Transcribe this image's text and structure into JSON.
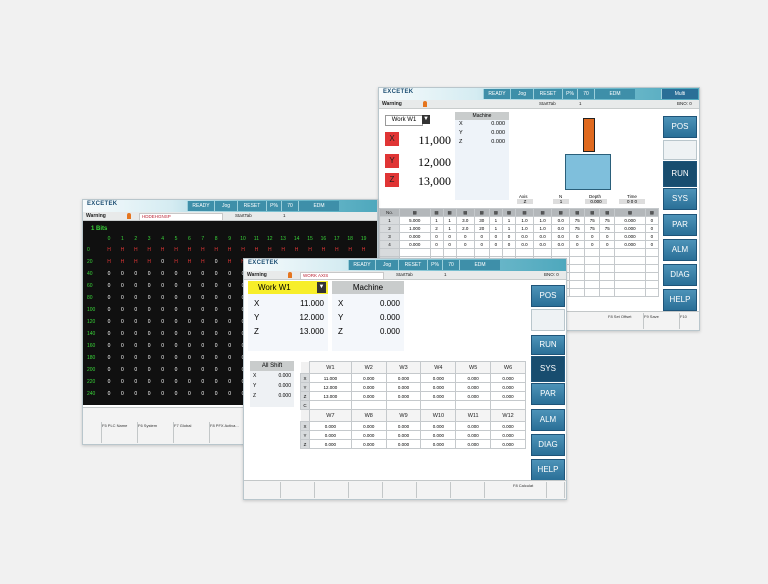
{
  "common": {
    "logo": "EXCETEK",
    "buttons": [
      "READY",
      "Jog",
      "RESET",
      "P%",
      "70",
      "EDM"
    ],
    "status_warning": "Warning"
  },
  "back_window": {
    "toolbar_extra": [
      "Multi"
    ],
    "status_mid": "StartTab",
    "status_num": "1",
    "status_right": "BNO: 0",
    "work": {
      "label": "Work W1",
      "axes": [
        {
          "axis": "X",
          "value": "11,000"
        },
        {
          "axis": "Y",
          "value": "12,000"
        },
        {
          "axis": "Z",
          "value": "13,000"
        }
      ]
    },
    "machine": {
      "label": "Machine",
      "rows": [
        {
          "axis": "X",
          "value": "0.000"
        },
        {
          "axis": "Y",
          "value": "0.000"
        },
        {
          "axis": "Z",
          "value": "0.000"
        }
      ]
    },
    "info": [
      {
        "label": "Axis",
        "value": "Z"
      },
      {
        "label": "N",
        "value": "1"
      },
      {
        "label": "Depth",
        "value": "0.000"
      },
      {
        "label": "Time",
        "value": "0   0   0"
      }
    ],
    "side_buttons": [
      "POS",
      "",
      "RUN",
      "SYS",
      "PAR",
      "ALM",
      "DIAG",
      "HELP"
    ],
    "table_header": [
      "No.",
      "",
      "",
      "",
      "",
      "",
      "",
      "",
      "",
      "",
      "",
      "",
      "",
      "",
      "",
      ""
    ],
    "table_rows": [
      [
        "1",
        "5.000",
        "1",
        "1",
        "3.0",
        "30",
        "1",
        "1",
        "1.0",
        "1.0",
        "0.0",
        "75",
        "75",
        "75",
        "0.000",
        "0"
      ],
      [
        "2",
        "1.000",
        "2",
        "1",
        "2.0",
        "20",
        "1",
        "1",
        "1.0",
        "1.0",
        "0.0",
        "75",
        "75",
        "75",
        "0.000",
        "0"
      ],
      [
        "3",
        "0.000",
        "0",
        "0",
        "0",
        "0",
        "0",
        "0",
        "0.0",
        "0.0",
        "0.0",
        "0",
        "0",
        "0",
        "0.000",
        "0"
      ],
      [
        "4",
        "0.000",
        "0",
        "0",
        "0",
        "0",
        "0",
        "0",
        "0.0",
        "0.0",
        "0.0",
        "0",
        "0",
        "0",
        "0.000",
        "0"
      ]
    ],
    "footer": [
      "",
      "",
      "",
      "",
      "",
      "F8 Set Offset",
      "F9 Save",
      "F10"
    ]
  },
  "plc_window": {
    "status_field": "HDDEHGNSP",
    "status_mid": "StartTab",
    "status_num": "1",
    "title": "1 Bits",
    "col_headers": [
      "0",
      "1",
      "2",
      "3",
      "4",
      "5",
      "6",
      "7",
      "8",
      "9",
      "10",
      "11",
      "12",
      "13",
      "14",
      "15",
      "16",
      "17",
      "18",
      "19"
    ],
    "rows": [
      {
        "label": "0",
        "vals": [
          "H",
          "H",
          "H",
          "H",
          "H",
          "H",
          "H",
          "H",
          "H",
          "H",
          "H",
          "H",
          "H",
          "H",
          "H",
          "H",
          "H",
          "H",
          "H",
          "H"
        ]
      },
      {
        "label": "20",
        "vals": [
          "H",
          "H",
          "H",
          "H",
          "0",
          "H",
          "H",
          "H",
          "0",
          "H",
          "H",
          "0",
          "0",
          "0",
          "0",
          "0",
          "0",
          "0",
          "0",
          "0"
        ]
      },
      {
        "label": "40",
        "vals": [
          "0",
          "0",
          "0",
          "0",
          "0",
          "0",
          "0",
          "0",
          "0",
          "0",
          "0",
          "0",
          "0",
          "0",
          "0",
          "0",
          "0",
          "0",
          "0",
          "0"
        ]
      },
      {
        "label": "60",
        "vals": [
          "0",
          "0",
          "0",
          "0",
          "0",
          "0",
          "0",
          "0",
          "0",
          "0",
          "0",
          "0",
          "0",
          "0",
          "0",
          "0",
          "0",
          "0",
          "0",
          "0"
        ]
      },
      {
        "label": "80",
        "vals": [
          "0",
          "0",
          "0",
          "0",
          "0",
          "0",
          "0",
          "0",
          "0",
          "0",
          "0",
          "0",
          "0",
          "0",
          "0",
          "0",
          "0",
          "0",
          "0",
          "0"
        ]
      },
      {
        "label": "100",
        "vals": [
          "0",
          "0",
          "0",
          "0",
          "0",
          "0",
          "0",
          "0",
          "0",
          "0",
          "0",
          "0",
          "0",
          "0",
          "0",
          "0",
          "0",
          "0",
          "0",
          "0"
        ]
      },
      {
        "label": "120",
        "vals": [
          "0",
          "0",
          "0",
          "0",
          "0",
          "0",
          "0",
          "0",
          "0",
          "0",
          "0",
          "0",
          "0",
          "0",
          "0",
          "0",
          "0",
          "0",
          "0",
          "0"
        ]
      },
      {
        "label": "140",
        "vals": [
          "0",
          "0",
          "0",
          "0",
          "0",
          "0",
          "0",
          "0",
          "0",
          "0",
          "0",
          "0",
          "0",
          "0",
          "0",
          "0",
          "0",
          "0",
          "0",
          "0"
        ]
      },
      {
        "label": "160",
        "vals": [
          "0",
          "0",
          "0",
          "0",
          "0",
          "0",
          "0",
          "0",
          "0",
          "0",
          "0",
          "0",
          "0",
          "0",
          "0",
          "0",
          "0",
          "0",
          "0",
          "0"
        ]
      },
      {
        "label": "180",
        "vals": [
          "0",
          "0",
          "0",
          "0",
          "0",
          "0",
          "0",
          "0",
          "0",
          "0",
          "0",
          "0",
          "0",
          "0",
          "0",
          "0",
          "0",
          "0",
          "0",
          "0"
        ]
      },
      {
        "label": "200",
        "vals": [
          "0",
          "0",
          "0",
          "0",
          "0",
          "0",
          "0",
          "0",
          "0",
          "0",
          "0",
          "0",
          "0",
          "0",
          "0",
          "0",
          "0",
          "0",
          "0",
          "0"
        ]
      },
      {
        "label": "220",
        "vals": [
          "0",
          "0",
          "0",
          "0",
          "0",
          "0",
          "0",
          "0",
          "0",
          "0",
          "0",
          "0",
          "0",
          "0",
          "0",
          "0",
          "0",
          "0",
          "0",
          "0"
        ]
      },
      {
        "label": "240",
        "vals": [
          "0",
          "0",
          "0",
          "0",
          "0",
          "0",
          "0",
          "0",
          "0",
          "0",
          "0",
          "0",
          "0",
          "0",
          "0",
          "0",
          "0",
          "0",
          "0",
          "0"
        ]
      }
    ],
    "footer": [
      "",
      "F5 PLC Name",
      "F6 System",
      "F7 Global",
      "F8 PFX Activa..."
    ]
  },
  "front_window": {
    "status_field": "WORK AXIS",
    "status_mid": "StartTab",
    "status_num": "1",
    "status_right": "BNO: 0",
    "work": {
      "label": "Work W1",
      "rows": [
        {
          "axis": "X",
          "value": "11.000"
        },
        {
          "axis": "Y",
          "value": "12.000"
        },
        {
          "axis": "Z",
          "value": "13.000"
        }
      ]
    },
    "machine": {
      "label": "Machine",
      "rows": [
        {
          "axis": "X",
          "value": "0.000"
        },
        {
          "axis": "Y",
          "value": "0.000"
        },
        {
          "axis": "Z",
          "value": "0.000"
        }
      ]
    },
    "all_shift": {
      "label": "All Shift",
      "rows": [
        {
          "axis": "X",
          "value": "0.000"
        },
        {
          "axis": "Y",
          "value": "0.000"
        },
        {
          "axis": "Z",
          "value": "0.000"
        }
      ]
    },
    "offsets_top": {
      "headers": [
        "W1",
        "W2",
        "W3",
        "W4",
        "W5",
        "W6"
      ],
      "axes": [
        "X",
        "Y",
        "Z",
        "C"
      ],
      "rows": [
        [
          "11.000",
          "0.000",
          "0.000",
          "0.000",
          "0.000",
          "0.000"
        ],
        [
          "12.000",
          "0.000",
          "0.000",
          "0.000",
          "0.000",
          "0.000"
        ],
        [
          "13.000",
          "0.000",
          "0.000",
          "0.000",
          "0.000",
          "0.000"
        ],
        [
          "",
          "",
          "",
          "",
          "",
          ""
        ]
      ]
    },
    "offsets_bottom": {
      "headers": [
        "W7",
        "W8",
        "W9",
        "W10",
        "W11",
        "W12"
      ],
      "axes": [
        "X",
        "Y",
        "Z"
      ],
      "rows": [
        [
          "0.000",
          "0.000",
          "0.000",
          "0.000",
          "0.000",
          "0.000"
        ],
        [
          "0.000",
          "0.000",
          "0.000",
          "0.000",
          "0.000",
          "0.000"
        ],
        [
          "0.000",
          "0.000",
          "0.000",
          "0.000",
          "0.000",
          "0.000"
        ]
      ]
    },
    "side_buttons": [
      "POS",
      "",
      "RUN",
      "SYS",
      "PAR",
      "ALM",
      "DIAG",
      "HELP"
    ],
    "footer": [
      "",
      "",
      "",
      "",
      "",
      "",
      "",
      "F8 Calculat",
      ""
    ]
  },
  "colors": {
    "accent": "#2a6f97",
    "work_yellow": "#f7ee2a",
    "axis_red": "#e03535",
    "plc_green": "#39d439",
    "plc_red": "#e03535"
  }
}
